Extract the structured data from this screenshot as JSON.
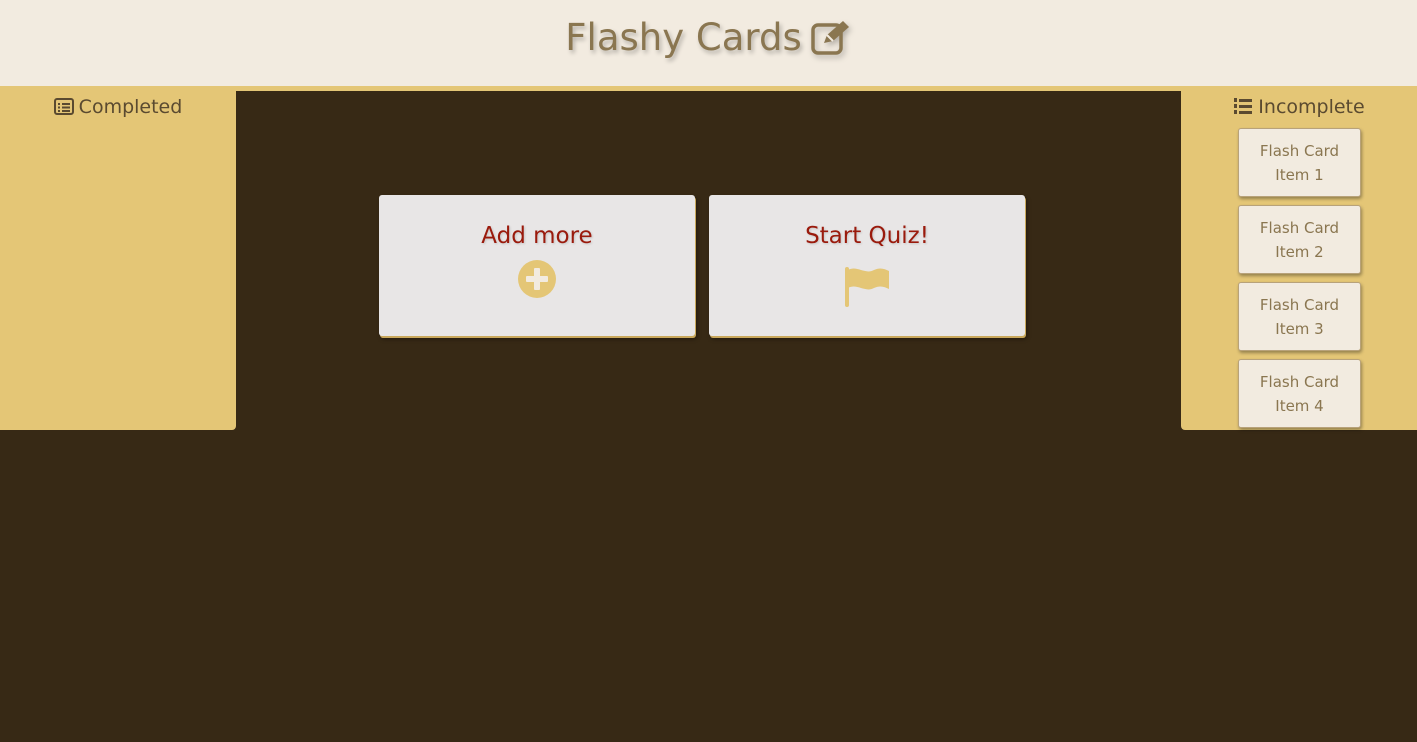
{
  "header": {
    "title": "Flashy Cards",
    "icon": "edit-icon"
  },
  "completed": {
    "heading": "Completed",
    "icon": "list-alt-icon",
    "items": []
  },
  "incomplete": {
    "heading": "Incomplete",
    "icon": "list-ol-icon",
    "items": [
      {
        "label": "Flash Card Item 1"
      },
      {
        "label": "Flash Card Item 2"
      },
      {
        "label": "Flash Card Item 3"
      },
      {
        "label": "Flash Card Item 4"
      }
    ]
  },
  "actions": {
    "add": {
      "label": "Add more",
      "icon": "plus-circle-icon"
    },
    "quiz": {
      "label": "Start Quiz!",
      "icon": "flag-icon"
    }
  },
  "colors": {
    "background": "#372915",
    "header": "#f2ebe0",
    "sidebar": "#e4c676",
    "title": "#8a7650",
    "action_text": "#9a1a0c"
  }
}
